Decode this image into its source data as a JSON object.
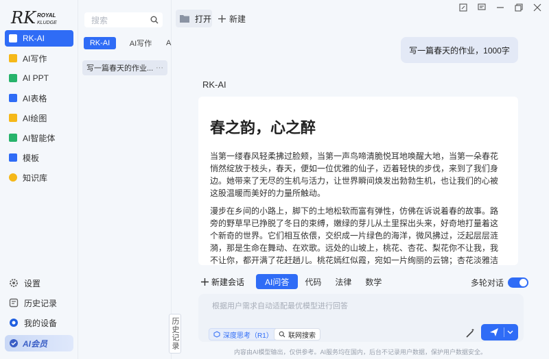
{
  "brand": {
    "logo_main": "RK",
    "logo_sub1": "ROYAL",
    "logo_sub2": "KLUDGE"
  },
  "nav": {
    "items": [
      {
        "label": "RK-AI",
        "color": "#ffffff"
      },
      {
        "label": "AI写作",
        "color": "#f5b819"
      },
      {
        "label": "AI PPT",
        "color": "#27b36b"
      },
      {
        "label": "AI表格",
        "color": "#2f6cf6"
      },
      {
        "label": "AI绘图",
        "color": "#f5b819"
      },
      {
        "label": "AI智能体",
        "color": "#27b36b"
      },
      {
        "label": "模板",
        "color": "#2f6cf6"
      },
      {
        "label": "知识库",
        "color": "#f5b819"
      }
    ],
    "bottom": [
      {
        "label": "设置",
        "icon": "gear-icon"
      },
      {
        "label": "历史记录",
        "icon": "history-icon"
      },
      {
        "label": "我的设备",
        "icon": "device-icon"
      }
    ],
    "vip_label": "AI会员"
  },
  "history": {
    "search_placeholder": "搜索",
    "tabs": [
      "RK-AI",
      "AI写作",
      "A"
    ],
    "items": [
      {
        "title": "写一篇春天的作业...",
        "more": "···"
      }
    ],
    "toggle_label": "历史记录"
  },
  "topbar": {
    "open_label": "打开",
    "new_label": "新建"
  },
  "chat": {
    "user_message": "写一篇春天的作业，1000字",
    "bot_name": "RK-AI",
    "article_title": "春之韵，心之醉",
    "paragraphs": [
      "当第一缕春风轻柔拂过脸颊，当第一声鸟啼清脆悦耳地唤醒大地，当第一朵春花悄然绽放于枝头，春天，便如一位优雅的仙子，迈着轻快的步伐，来到了我们身边。她带来了无尽的生机与活力，让世界瞬间焕发出勃勃生机，也让我们的心被这股温暖而美好的力量所触动。",
      "漫步在乡间的小路上，脚下的土地松软而富有弹性，仿佛在诉说着春的故事。路旁的野草早已挣脱了冬日的束缚，嫩绿的芽儿从土里探出头来，好奇地打量着这个新奇的世界。它们相互依偎，交织成一片绿色的海洋，微风拂过，泛起层层涟漪，那是生命在舞动、在欢歌。远处的山坡上，桃花、杏花、梨花你不让我，我不让你，都开满了花赶趟儿。桃花嫣红似霞，宛如一片绚丽的云锦；杏花淡雅洁白，散发着一缕缕清幽"
    ]
  },
  "composer": {
    "new_conv_label": "新建会话",
    "modes": [
      "AI问答",
      "代码",
      "法律",
      "数学"
    ],
    "active_mode": "AI问答",
    "multi_turn_label": "多轮对话",
    "multi_turn_on": true,
    "placeholder": "根据用户需求自动适配最优模型进行回答",
    "chip_deep": "深度思考（R1）",
    "chip_web": "联网搜索"
  },
  "footer": "内容由AI模型输出，仅供参考。AI服务均在国内，后台不记录用户数据，保护用户数据安全。",
  "colors": {
    "accent": "#2f6cf6",
    "background": "#f4f7fb"
  }
}
